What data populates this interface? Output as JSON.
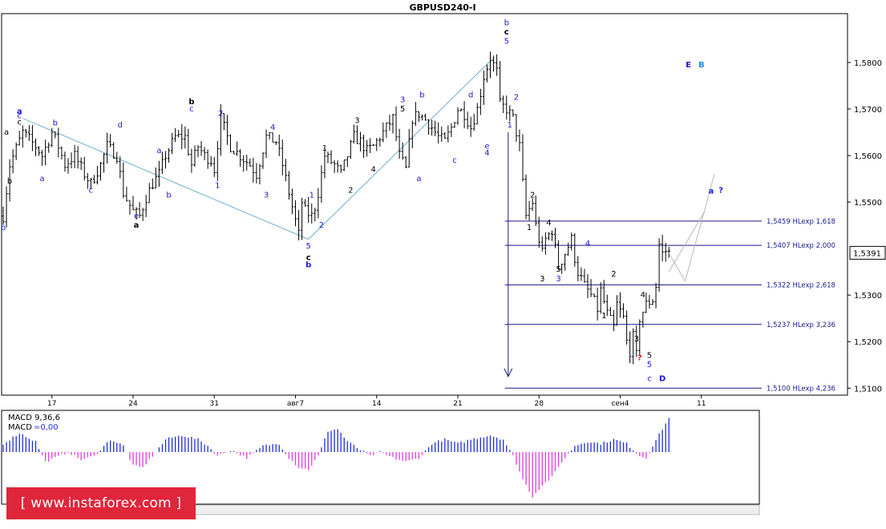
{
  "chart_data": {
    "type": "ohlc",
    "title": "GBPUSD240-I",
    "current_price_label": "1,5391",
    "colors": {
      "bars": "#000000",
      "wave_blue": "#1a1adc",
      "wave_black": "#000000",
      "channel": "#5fa6c8",
      "levels": "#1a1a8c",
      "macd_pos": "#1f2fd6",
      "macd_neg": "#e23be0",
      "question_red": "#e02020",
      "label_B": "#1e8ed8"
    },
    "y_axis": {
      "ylim": [
        1.5085,
        1.5905
      ],
      "ticks": [
        {
          "value": 1.58,
          "label": "1,5800"
        },
        {
          "value": 1.57,
          "label": "1,5700"
        },
        {
          "value": 1.56,
          "label": "1,5600"
        },
        {
          "value": 1.55,
          "label": "1,5500"
        },
        {
          "value": 1.53,
          "label": "1,5300"
        },
        {
          "value": 1.52,
          "label": "1,5200"
        },
        {
          "value": 1.51,
          "label": "1,5100"
        }
      ]
    },
    "x_axis": {
      "ticks": [
        {
          "bar": 15,
          "label": "17"
        },
        {
          "bar": 40,
          "label": "24"
        },
        {
          "bar": 65,
          "label": "31"
        },
        {
          "bar": 90,
          "label": "авг7"
        },
        {
          "bar": 115,
          "label": "14"
        },
        {
          "bar": 140,
          "label": "21"
        },
        {
          "bar": 165,
          "label": "28"
        },
        {
          "bar": 190,
          "label": "сен4"
        },
        {
          "bar": 215,
          "label": "11"
        }
      ]
    },
    "close_anchors": [
      [
        0,
        1.547
      ],
      [
        2,
        1.558
      ],
      [
        6,
        1.565
      ],
      [
        10,
        1.562
      ],
      [
        12,
        1.56
      ],
      [
        15,
        1.565
      ],
      [
        17,
        1.562
      ],
      [
        19,
        1.558
      ],
      [
        22,
        1.56
      ],
      [
        25,
        1.556
      ],
      [
        27,
        1.554
      ],
      [
        30,
        1.558
      ],
      [
        32,
        1.562
      ],
      [
        35,
        1.56
      ],
      [
        37,
        1.552
      ],
      [
        40,
        1.548
      ],
      [
        42,
        1.547
      ],
      [
        44,
        1.551
      ],
      [
        46,
        1.554
      ],
      [
        48,
        1.556
      ],
      [
        50,
        1.56
      ],
      [
        53,
        1.564
      ],
      [
        56,
        1.564
      ],
      [
        58,
        1.558
      ],
      [
        60,
        1.562
      ],
      [
        62,
        1.56
      ],
      [
        64,
        1.559
      ],
      [
        65,
        1.557
      ],
      [
        67,
        1.568
      ],
      [
        70,
        1.562
      ],
      [
        73,
        1.56
      ],
      [
        76,
        1.558
      ],
      [
        78,
        1.556
      ],
      [
        81,
        1.564
      ],
      [
        84,
        1.563
      ],
      [
        86,
        1.558
      ],
      [
        88,
        1.552
      ],
      [
        90,
        1.546
      ],
      [
        91,
        1.543
      ],
      [
        92,
        1.55
      ],
      [
        93,
        1.548
      ],
      [
        95,
        1.547
      ],
      [
        96,
        1.549
      ],
      [
        97,
        1.552
      ],
      [
        99,
        1.56
      ],
      [
        102,
        1.558
      ],
      [
        104,
        1.556
      ],
      [
        106,
        1.56
      ],
      [
        108,
        1.564
      ],
      [
        110,
        1.563
      ],
      [
        112,
        1.561
      ],
      [
        114,
        1.562
      ],
      [
        117,
        1.565
      ],
      [
        120,
        1.568
      ],
      [
        122,
        1.56
      ],
      [
        124,
        1.557
      ],
      [
        126,
        1.568
      ],
      [
        128,
        1.569
      ],
      [
        131,
        1.567
      ],
      [
        134,
        1.564
      ],
      [
        136,
        1.563
      ],
      [
        138,
        1.566
      ],
      [
        140,
        1.57
      ],
      [
        142,
        1.569
      ],
      [
        144,
        1.566
      ],
      [
        146,
        1.57
      ],
      [
        148,
        1.577
      ],
      [
        150,
        1.581
      ],
      [
        152,
        1.578
      ],
      [
        153,
        1.571
      ],
      [
        155,
        1.57
      ],
      [
        157,
        1.568
      ],
      [
        159,
        1.562
      ],
      [
        160,
        1.554
      ],
      [
        161,
        1.547
      ],
      [
        163,
        1.55
      ],
      [
        164,
        1.545
      ],
      [
        166,
        1.539
      ],
      [
        167,
        1.542
      ],
      [
        169,
        1.544
      ],
      [
        171,
        1.536
      ],
      [
        173,
        1.539
      ],
      [
        175,
        1.542
      ],
      [
        176,
        1.538
      ],
      [
        177,
        1.535
      ],
      [
        179,
        1.532
      ],
      [
        181,
        1.53
      ],
      [
        183,
        1.527
      ],
      [
        184,
        1.531
      ],
      [
        186,
        1.526
      ],
      [
        188,
        1.523
      ],
      [
        189,
        1.528
      ],
      [
        191,
        1.525
      ],
      [
        192,
        1.52
      ],
      [
        193,
        1.518
      ],
      [
        194,
        1.521
      ],
      [
        195,
        1.517
      ],
      [
        196,
        1.525
      ],
      [
        198,
        1.528
      ],
      [
        200,
        1.529
      ],
      [
        201,
        1.532
      ],
      [
        202,
        1.541
      ],
      [
        203,
        1.539
      ],
      [
        204,
        1.5395
      ],
      [
        205,
        1.5391
      ]
    ],
    "fib_levels": [
      {
        "value": 1.5459,
        "label": "1,5459 HLexp 1,618"
      },
      {
        "value": 1.5407,
        "label": "1,5407 HLexp 2,000"
      },
      {
        "value": 1.5322,
        "label": "1,5322 HLexp 2,618"
      },
      {
        "value": 1.5237,
        "label": "1,5237 HLexp 3,236"
      },
      {
        "value": 1.51,
        "label": "1,5100 HLexp 4,236"
      }
    ],
    "channel_lines": [
      {
        "from": [
          6,
          1.568
        ],
        "to": [
          94,
          1.542
        ]
      },
      {
        "from": [
          94,
          1.542
        ],
        "to": [
          151,
          1.581
        ]
      }
    ],
    "projection_lines": [
      {
        "from": [
          205,
          1.539
        ],
        "to": [
          210,
          1.533
        ]
      },
      {
        "from": [
          210,
          1.533
        ],
        "to": [
          219,
          1.556
        ]
      },
      {
        "from": [
          205,
          1.535
        ],
        "to": [
          216,
          1.548
        ]
      }
    ],
    "drop_arrow": {
      "bar": 156,
      "from": 1.565,
      "to": 1.5125
    },
    "wave_labels": [
      {
        "text": "b",
        "bar": 0,
        "price": 1.544,
        "color": "blue"
      },
      {
        "text": "a",
        "bar": 5,
        "price": 1.569,
        "color": "blue",
        "bold": true
      },
      {
        "text": "c",
        "bar": 5,
        "price": 1.568,
        "color": "blue"
      },
      {
        "text": "c",
        "bar": 5,
        "price": 1.5666,
        "color": "black"
      },
      {
        "text": "a",
        "bar": 1,
        "price": 1.5645,
        "color": "black"
      },
      {
        "text": "b",
        "bar": 2,
        "price": 1.554,
        "color": "black"
      },
      {
        "text": "b",
        "bar": 16,
        "price": 1.5665,
        "color": "blue"
      },
      {
        "text": "a",
        "bar": 12,
        "price": 1.5545,
        "color": "blue"
      },
      {
        "text": "c",
        "bar": 27,
        "price": 1.552,
        "color": "blue"
      },
      {
        "text": "d",
        "bar": 36,
        "price": 1.566,
        "color": "blue"
      },
      {
        "text": "e",
        "bar": 41,
        "price": 1.5465,
        "color": "blue"
      },
      {
        "text": "a",
        "bar": 41,
        "price": 1.5445,
        "color": "black",
        "bold": true
      },
      {
        "text": "a",
        "bar": 48,
        "price": 1.5605,
        "color": "blue"
      },
      {
        "text": "b",
        "bar": 51,
        "price": 1.551,
        "color": "blue"
      },
      {
        "text": "b",
        "bar": 58,
        "price": 1.571,
        "color": "black",
        "bold": true
      },
      {
        "text": "c",
        "bar": 58,
        "price": 1.5695,
        "color": "blue"
      },
      {
        "text": "2",
        "bar": 67,
        "price": 1.5685,
        "color": "blue"
      },
      {
        "text": "1",
        "bar": 66,
        "price": 1.553,
        "color": "blue"
      },
      {
        "text": "3",
        "bar": 81,
        "price": 1.551,
        "color": "blue"
      },
      {
        "text": "4",
        "bar": 83,
        "price": 1.5655,
        "color": "blue"
      },
      {
        "text": "5",
        "bar": 94,
        "price": 1.54,
        "color": "blue"
      },
      {
        "text": "c",
        "bar": 94,
        "price": 1.5375,
        "color": "black",
        "bold": true
      },
      {
        "text": "b",
        "bar": 94,
        "price": 1.536,
        "color": "blue",
        "bold": true
      },
      {
        "text": "1",
        "bar": 95,
        "price": 1.551,
        "color": "blue"
      },
      {
        "text": "2",
        "bar": 98,
        "price": 1.5445,
        "color": "blue"
      },
      {
        "text": "1",
        "bar": 99,
        "price": 1.561,
        "color": "black"
      },
      {
        "text": "2",
        "bar": 107,
        "price": 1.552,
        "color": "black"
      },
      {
        "text": "3",
        "bar": 109,
        "price": 1.567,
        "color": "black"
      },
      {
        "text": "4",
        "bar": 114,
        "price": 1.5565,
        "color": "black"
      },
      {
        "text": "3",
        "bar": 123,
        "price": 1.5715,
        "color": "blue"
      },
      {
        "text": "5",
        "bar": 123,
        "price": 1.5695,
        "color": "black"
      },
      {
        "text": "a",
        "bar": 128,
        "price": 1.5545,
        "color": "blue"
      },
      {
        "text": "b",
        "bar": 129,
        "price": 1.5725,
        "color": "blue"
      },
      {
        "text": "c",
        "bar": 139,
        "price": 1.5585,
        "color": "blue"
      },
      {
        "text": "d",
        "bar": 144,
        "price": 1.5725,
        "color": "blue"
      },
      {
        "text": "e",
        "bar": 149,
        "price": 1.5615,
        "color": "blue"
      },
      {
        "text": "4",
        "bar": 149,
        "price": 1.56,
        "color": "blue"
      },
      {
        "text": "b",
        "bar": 155,
        "price": 1.588,
        "color": "blue"
      },
      {
        "text": "c",
        "bar": 155,
        "price": 1.586,
        "color": "black",
        "bold": true
      },
      {
        "text": "5",
        "bar": 155,
        "price": 1.584,
        "color": "blue"
      },
      {
        "text": "2",
        "bar": 158,
        "price": 1.572,
        "color": "blue"
      },
      {
        "text": "1",
        "bar": 156,
        "price": 1.566,
        "color": "blue"
      },
      {
        "text": "2",
        "bar": 163,
        "price": 1.551,
        "color": "black"
      },
      {
        "text": "1",
        "bar": 162,
        "price": 1.544,
        "color": "black"
      },
      {
        "text": "4",
        "bar": 168,
        "price": 1.545,
        "color": "black"
      },
      {
        "text": "3",
        "bar": 166,
        "price": 1.533,
        "color": "black"
      },
      {
        "text": "5",
        "bar": 171,
        "price": 1.535,
        "color": "black"
      },
      {
        "text": "3",
        "bar": 171,
        "price": 1.533,
        "color": "blue"
      },
      {
        "text": "4",
        "bar": 180,
        "price": 1.5405,
        "color": "blue"
      },
      {
        "text": "2",
        "bar": 188,
        "price": 1.534,
        "color": "black"
      },
      {
        "text": "1",
        "bar": 185,
        "price": 1.525,
        "color": "black"
      },
      {
        "text": "4",
        "bar": 197,
        "price": 1.5295,
        "color": "black"
      },
      {
        "text": "3",
        "bar": 195,
        "price": 1.52,
        "color": "black"
      },
      {
        "text": "5",
        "bar": 199,
        "price": 1.5165,
        "color": "black"
      },
      {
        "text": "?",
        "bar": 196,
        "price": 1.516,
        "color": "red",
        "bold": true
      },
      {
        "text": "5",
        "bar": 199,
        "price": 1.5145,
        "color": "blue"
      },
      {
        "text": "c",
        "bar": 199,
        "price": 1.5115,
        "color": "blue"
      },
      {
        "text": "D",
        "bar": 203,
        "price": 1.5115,
        "color": "blue",
        "bold": true
      },
      {
        "text": "E",
        "bar": 211,
        "price": 1.579,
        "color": "blue",
        "bold": true
      },
      {
        "text": "B",
        "bar": 215,
        "price": 1.579,
        "color": "lightblue",
        "bold": true
      },
      {
        "text": "a",
        "bar": 218,
        "price": 1.5518,
        "color": "blue",
        "bold": true
      },
      {
        "text": "?",
        "bar": 221,
        "price": 1.552,
        "color": "blue",
        "bold": true
      }
    ],
    "macd": {
      "label1": "MACD 9,36,6",
      "label2_prefix": "MACD",
      "label2_value": "=0,00",
      "anchors": [
        [
          0,
          0.4
        ],
        [
          5,
          0.9
        ],
        [
          10,
          0.5
        ],
        [
          13,
          -0.5
        ],
        [
          16,
          -0.3
        ],
        [
          20,
          0.0
        ],
        [
          24,
          -0.4
        ],
        [
          28,
          -0.2
        ],
        [
          33,
          0.6
        ],
        [
          37,
          0.3
        ],
        [
          40,
          -0.7
        ],
        [
          43,
          -0.8
        ],
        [
          46,
          -0.2
        ],
        [
          50,
          0.6
        ],
        [
          55,
          0.8
        ],
        [
          60,
          0.6
        ],
        [
          63,
          0.3
        ],
        [
          66,
          -0.2
        ],
        [
          70,
          0.1
        ],
        [
          75,
          -0.3
        ],
        [
          80,
          0.3
        ],
        [
          85,
          0.4
        ],
        [
          88,
          -0.3
        ],
        [
          91,
          -0.8
        ],
        [
          94,
          -0.9
        ],
        [
          97,
          -0.2
        ],
        [
          100,
          1.0
        ],
        [
          103,
          1.1
        ],
        [
          106,
          0.5
        ],
        [
          110,
          0.1
        ],
        [
          113,
          -0.2
        ],
        [
          116,
          0.0
        ],
        [
          120,
          -0.3
        ],
        [
          124,
          -0.5
        ],
        [
          128,
          -0.3
        ],
        [
          132,
          0.4
        ],
        [
          136,
          0.6
        ],
        [
          140,
          0.4
        ],
        [
          144,
          0.6
        ],
        [
          150,
          0.8
        ],
        [
          154,
          0.6
        ],
        [
          157,
          -0.2
        ],
        [
          160,
          -1.4
        ],
        [
          163,
          -2.3
        ],
        [
          166,
          -1.7
        ],
        [
          169,
          -1.3
        ],
        [
          172,
          -0.5
        ],
        [
          176,
          0.3
        ],
        [
          180,
          0.5
        ],
        [
          184,
          0.4
        ],
        [
          188,
          0.6
        ],
        [
          192,
          0.4
        ],
        [
          196,
          -0.2
        ],
        [
          198,
          -0.3
        ],
        [
          200,
          0.3
        ],
        [
          203,
          1.1
        ],
        [
          205,
          1.6
        ]
      ],
      "range": [
        -2.6,
        1.9
      ]
    }
  },
  "watermark": {
    "text": "[ www.instaforex.com ]"
  }
}
